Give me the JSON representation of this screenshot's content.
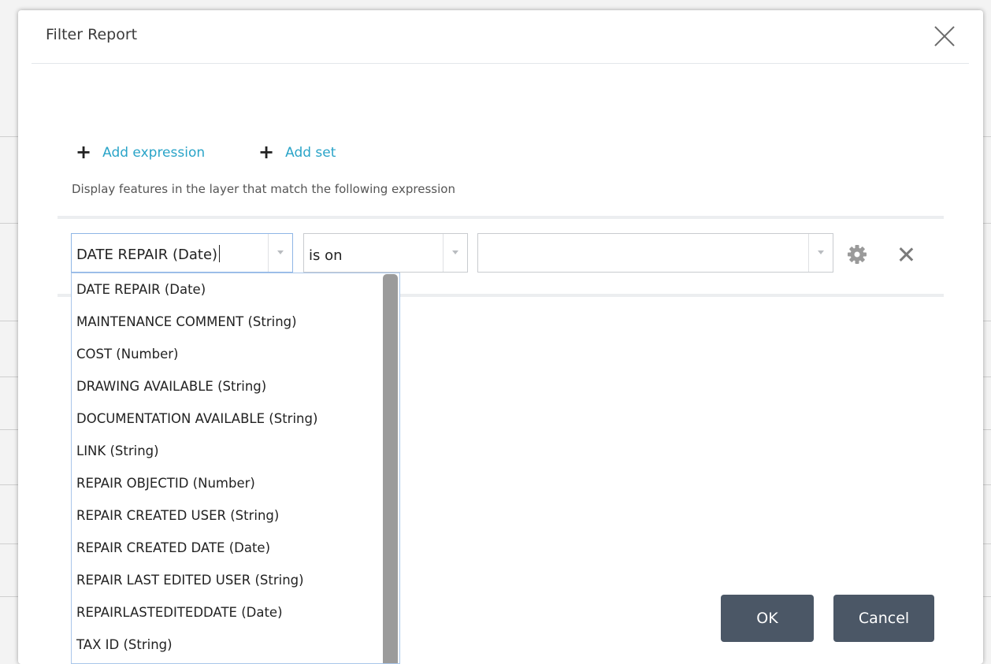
{
  "dialog": {
    "title": "Filter Report"
  },
  "actions": {
    "add_expression": "Add expression",
    "add_set": "Add set",
    "plus_glyph": "+"
  },
  "hint": "Display features in the layer that match the following expression",
  "expression": {
    "field_value": "DATE REPAIR (Date)",
    "operator_value": "is on",
    "value_field": ""
  },
  "field_options": [
    "DATE REPAIR (Date)",
    "MAINTENANCE COMMENT (String)",
    "COST (Number)",
    "DRAWING AVAILABLE (String)",
    "DOCUMENTATION AVAILABLE (String)",
    "LINK (String)",
    "REPAIR OBJECTID (Number)",
    "REPAIR CREATED USER (String)",
    "REPAIR CREATED DATE (Date)",
    "REPAIR LAST EDITED USER (String)",
    "REPAIRLASTEDITEDDATE (Date)",
    "TAX ID (String)"
  ],
  "footer": {
    "ok": "OK",
    "cancel": "Cancel"
  },
  "colors": {
    "link": "#2aa4c8",
    "button": "#4b5766",
    "dropdown_border": "#a9c6ea"
  }
}
